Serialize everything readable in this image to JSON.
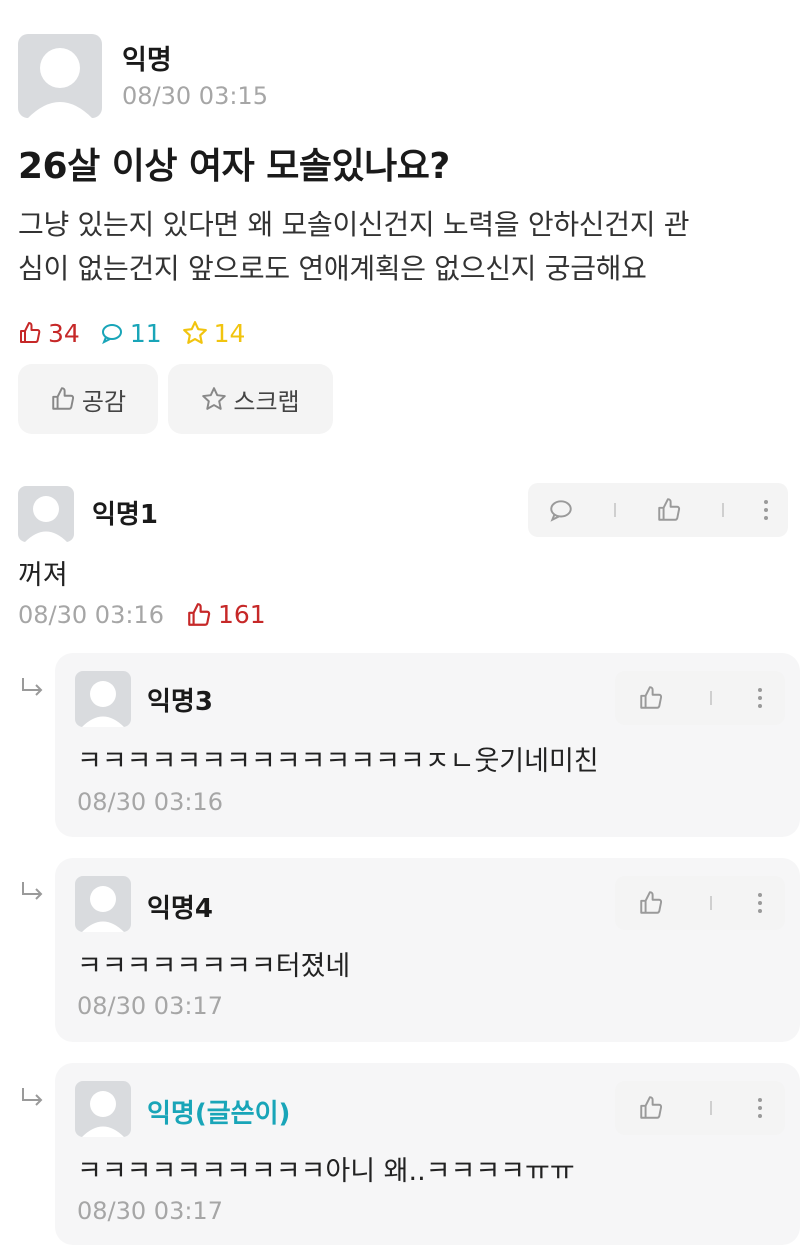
{
  "post": {
    "author": "익명",
    "date": "08/30 03:15",
    "title": "26살 이상 여자 모솔있나요?",
    "body_line1": "그냥 있는지 있다면 왜 모솔이신건지 노력을 안하신건지 관",
    "body_line2": "심이 없는건지 앞으로도 연애계획은 없으신지 궁금해요",
    "likes": "34",
    "comments": "11",
    "scraps": "14",
    "like_button": "공감",
    "scrap_button": "스크랩"
  },
  "comment": {
    "name": "익명1",
    "text": "꺼져",
    "date": "08/30 03:16",
    "likes": "161"
  },
  "replies": [
    {
      "name": "익명3",
      "text": "ㅋㅋㅋㅋㅋㅋㅋㅋㅋㅋㅋㅋㅋㅋㅈㄴ웃기네미친",
      "date": "08/30 03:16"
    },
    {
      "name": "익명4",
      "text": "ㅋㅋㅋㅋㅋㅋㅋㅋ터졌네",
      "date": "08/30 03:17"
    },
    {
      "name": "익명(글쓴이)",
      "text": "ㅋㅋㅋㅋㅋㅋㅋㅋㅋㅋ아니 왜..ㅋㅋㅋㅋㅠㅠ",
      "date": "08/30 03:17"
    }
  ],
  "colors": {
    "like": "#c62828",
    "comment": "#19a5b8",
    "scrap": "#f1c40f",
    "author_highlight": "#19a5b8"
  }
}
